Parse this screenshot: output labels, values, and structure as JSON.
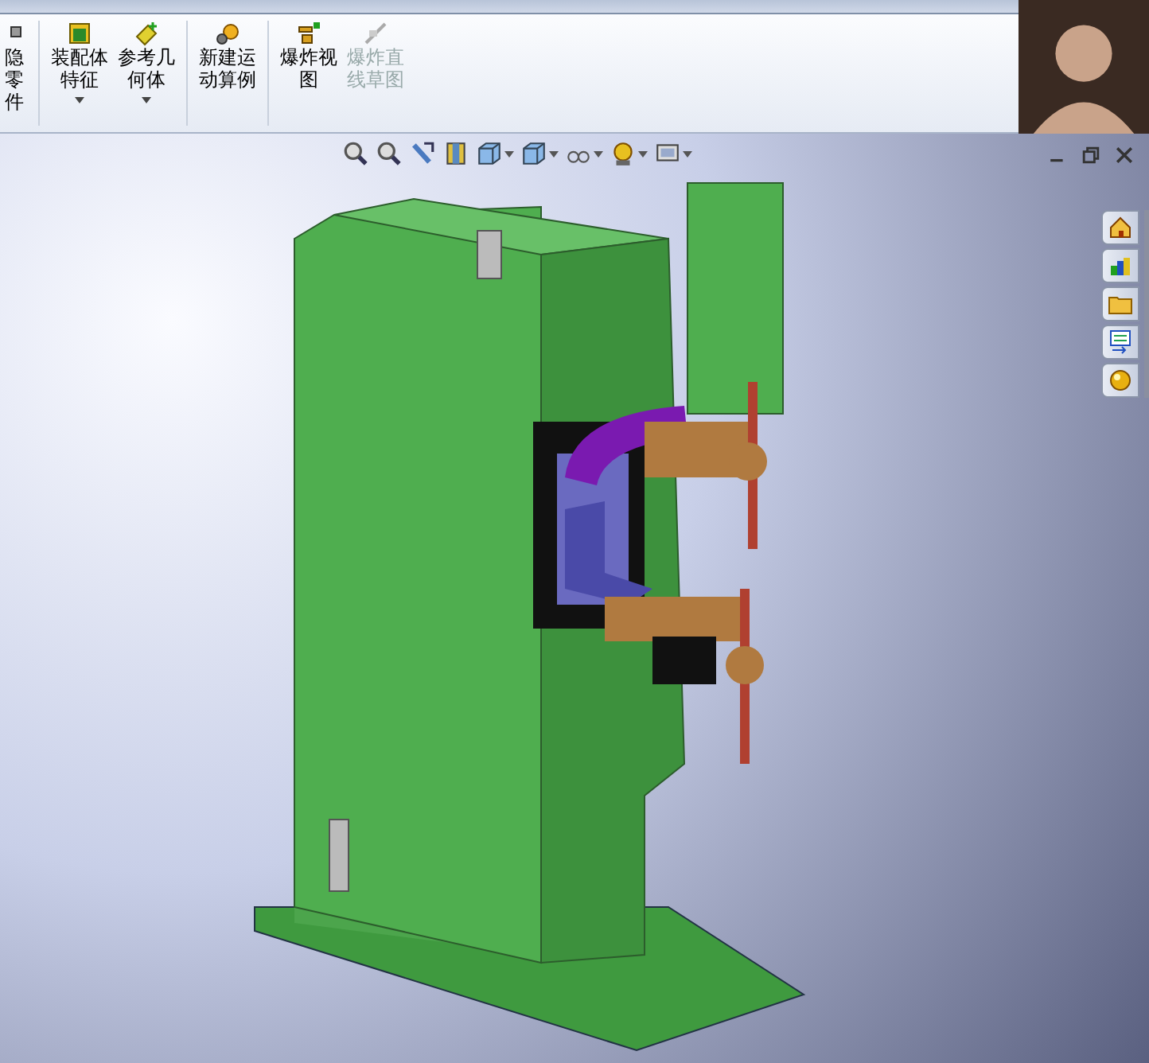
{
  "ribbon": {
    "groups": [
      {
        "buttons": [
          {
            "lines": [
              "隐",
              "零",
              "件"
            ],
            "kind": "cut",
            "dropdown": false,
            "disabled": false
          }
        ]
      },
      {
        "buttons": [
          {
            "lines": [
              "装配体",
              "特征"
            ],
            "kind": "assembly",
            "dropdown": true,
            "disabled": false
          },
          {
            "lines": [
              "参考几",
              "何体"
            ],
            "kind": "reference",
            "dropdown": true,
            "disabled": false
          }
        ]
      },
      {
        "buttons": [
          {
            "lines": [
              "新建运",
              "动算例"
            ],
            "kind": "motion",
            "dropdown": false,
            "disabled": false
          }
        ]
      },
      {
        "buttons": [
          {
            "lines": [
              "爆炸视",
              "图"
            ],
            "kind": "explode",
            "dropdown": false,
            "disabled": false
          },
          {
            "lines": [
              "爆炸直",
              "线草图"
            ],
            "kind": "explode-line",
            "dropdown": false,
            "disabled": true
          }
        ]
      }
    ]
  },
  "view_toolbar": [
    {
      "kind": "zoom-fit",
      "dropdown": false
    },
    {
      "kind": "zoom-area",
      "dropdown": false
    },
    {
      "kind": "previous",
      "dropdown": false
    },
    {
      "kind": "section",
      "dropdown": false
    },
    {
      "kind": "orientation",
      "dropdown": true
    },
    {
      "kind": "display",
      "dropdown": true
    },
    {
      "kind": "hide",
      "dropdown": true
    },
    {
      "kind": "scene",
      "dropdown": true
    },
    {
      "kind": "settings",
      "dropdown": true
    }
  ],
  "task_pane": [
    {
      "kind": "home"
    },
    {
      "kind": "library"
    },
    {
      "kind": "folder"
    },
    {
      "kind": "properties"
    },
    {
      "kind": "appearance"
    }
  ]
}
